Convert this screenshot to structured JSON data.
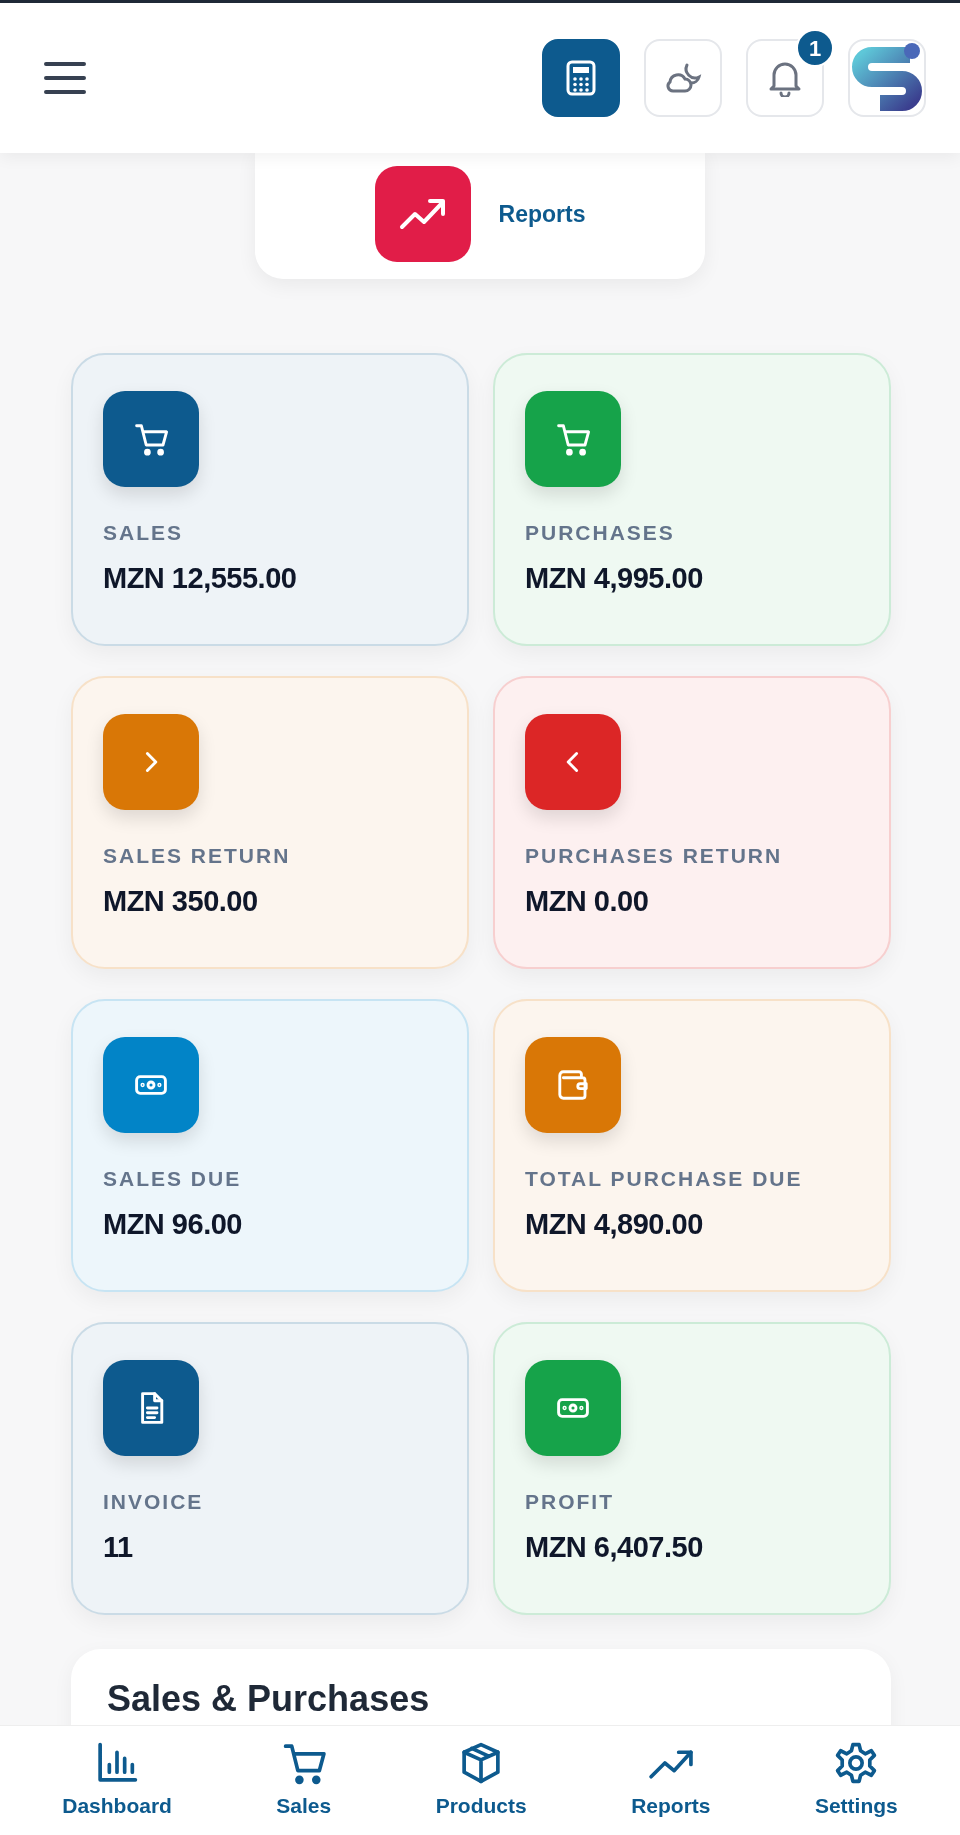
{
  "header": {
    "notification_count": "1"
  },
  "shortcut": {
    "label": "Reports"
  },
  "stats": [
    {
      "label": "SALES",
      "value": "MZN 12,555.00",
      "kind": "cart",
      "color": "#0d5a8e"
    },
    {
      "label": "PURCHASES",
      "value": "MZN 4,995.00",
      "kind": "cart",
      "color": "#16a34a"
    },
    {
      "label": "SALES RETURN",
      "value": "MZN 350.00",
      "kind": "chevron-right",
      "color": "#d97706"
    },
    {
      "label": "PURCHASES RETURN",
      "value": "MZN 0.00",
      "kind": "chevron-left",
      "color": "#dc2626"
    },
    {
      "label": "SALES DUE",
      "value": "MZN 96.00",
      "kind": "cash",
      "color": "#0284c7"
    },
    {
      "label": "TOTAL PURCHASE DUE",
      "value": "MZN 4,890.00",
      "kind": "wallet",
      "color": "#d97706"
    },
    {
      "label": "INVOICE",
      "value": "11",
      "kind": "document",
      "color": "#0d5a8e"
    },
    {
      "label": "PROFIT",
      "value": "MZN 6,407.50",
      "kind": "cash",
      "color": "#16a34a"
    }
  ],
  "section": {
    "title": "Sales & Purchases"
  },
  "bottom_nav": [
    {
      "label": "Dashboard",
      "kind": "chart"
    },
    {
      "label": "Sales",
      "kind": "cart"
    },
    {
      "label": "Products",
      "kind": "box"
    },
    {
      "label": "Reports",
      "kind": "trend"
    },
    {
      "label": "Settings",
      "kind": "gear"
    }
  ]
}
